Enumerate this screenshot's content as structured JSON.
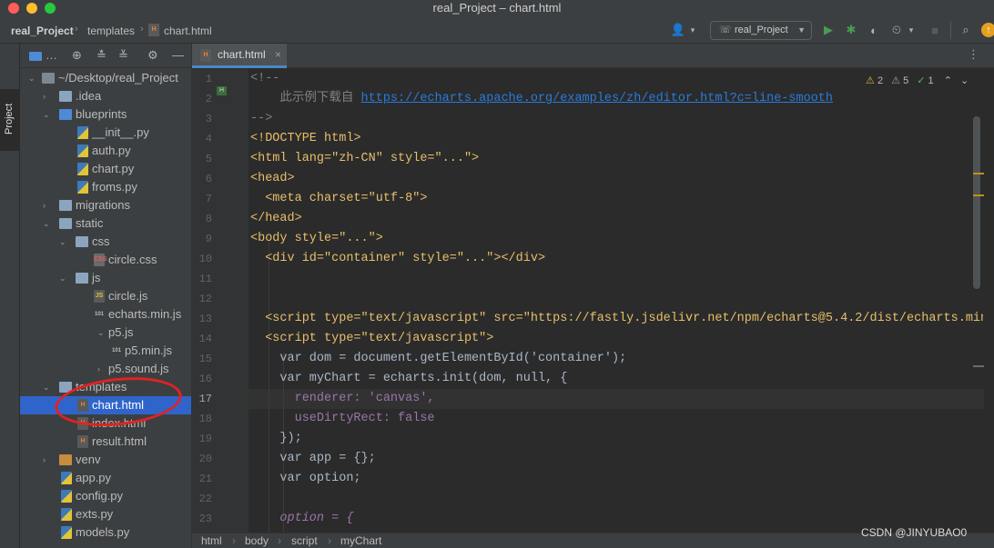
{
  "window": {
    "title": "real_Project – chart.html"
  },
  "navbar": {
    "crumbs": [
      "real_Project",
      "templates",
      "chart.html"
    ],
    "run_config": "real_Project"
  },
  "sidebar": {
    "label": "Project"
  },
  "tree": [
    {
      "label": "~/Desktop/real_Project",
      "kind": "folder-gray",
      "arrow": "v"
    },
    {
      "label": ".idea",
      "kind": "folder",
      "arrow": ">"
    },
    {
      "label": "blueprints",
      "kind": "folder-blue",
      "arrow": "v"
    },
    {
      "label": "__init__.py",
      "kind": "py"
    },
    {
      "label": "auth.py",
      "kind": "py"
    },
    {
      "label": "chart.py",
      "kind": "py"
    },
    {
      "label": "froms.py",
      "kind": "py"
    },
    {
      "label": "migrations",
      "kind": "folder",
      "arrow": ">"
    },
    {
      "label": "static",
      "kind": "folder",
      "arrow": "v"
    },
    {
      "label": "css",
      "kind": "folder",
      "arrow": "v"
    },
    {
      "label": "circle.css",
      "kind": "css"
    },
    {
      "label": "js",
      "kind": "folder",
      "arrow": "v"
    },
    {
      "label": "circle.js",
      "kind": "js"
    },
    {
      "label": "echarts.min.js",
      "kind": "num"
    },
    {
      "label": "p5.js",
      "kind": "js",
      "arrow": "v"
    },
    {
      "label": "p5.min.js",
      "kind": "num"
    },
    {
      "label": "p5.sound.js",
      "kind": "js",
      "arrow": ">"
    },
    {
      "label": "templates",
      "kind": "folder",
      "arrow": "v"
    },
    {
      "label": "chart.html",
      "kind": "html",
      "selected": true
    },
    {
      "label": "index.html",
      "kind": "html"
    },
    {
      "label": "result.html",
      "kind": "html"
    },
    {
      "label": "venv",
      "kind": "folder-orange",
      "arrow": ">"
    },
    {
      "label": "app.py",
      "kind": "py"
    },
    {
      "label": "config.py",
      "kind": "py"
    },
    {
      "label": "exts.py",
      "kind": "py"
    },
    {
      "label": "models.py",
      "kind": "py"
    }
  ],
  "editor": {
    "tab": "chart.html",
    "inspections": {
      "warnings": "2",
      "weak": "5",
      "ok": "1"
    },
    "lines": [
      "1",
      "2",
      "3",
      "4",
      "5",
      "6",
      "7",
      "8",
      "9",
      "10",
      "11",
      "12",
      "13",
      "14",
      "15",
      "16",
      "17",
      "18",
      "19",
      "20",
      "21",
      "22",
      "23"
    ],
    "code": {
      "l1": "<!--",
      "l2a": "    此示例下载自 ",
      "l2b": "https://echarts.apache.org/examples/zh/editor.html?c=line-smooth",
      "l3": "-->",
      "l4": "<!DOCTYPE html>",
      "l5": "<html lang=\"zh-CN\" style=\"...\">",
      "l6": "<head>",
      "l7": "  <meta charset=\"utf-8\">",
      "l8": "</head>",
      "l9": "<body style=\"...\">",
      "l10": "  <div id=\"container\" style=\"...\"></div>",
      "l13": "  <script type=\"text/javascript\" src=\"https://fastly.jsdelivr.net/npm/echarts@5.4.2/dist/echarts.min.",
      "l14": "  <script type=\"text/javascript\">",
      "l15": "    var dom = document.getElementById('container');",
      "l16": "    var myChart = echarts.init(dom, null, {",
      "l17": "      renderer: 'canvas',",
      "l18": "      useDirtyRect: false",
      "l19": "    });",
      "l20": "    var app = {};",
      "l21": "    var option;",
      "l23": "    option = {"
    }
  },
  "breadcrumb": [
    "html",
    "body",
    "script",
    "myChart"
  ],
  "watermark": "CSDN @JINYUBAO0"
}
